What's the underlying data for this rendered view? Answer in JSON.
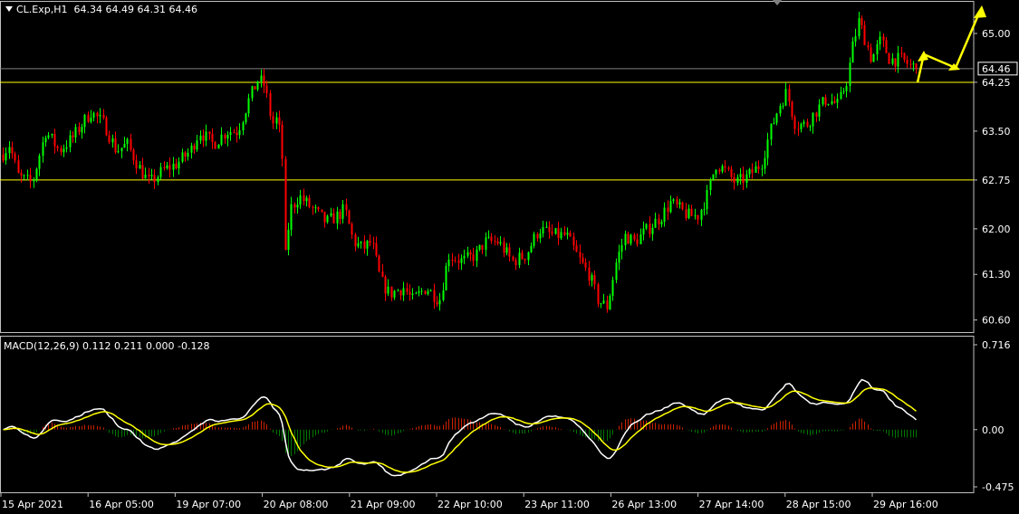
{
  "header": {
    "symbol": "CL.Exp,H1",
    "ohlc": "64.34 64.49 64.31 64.46"
  },
  "macd": {
    "label": "MACD(12,26,9) 0.112 0.211 0.000 -0.128"
  },
  "price_axis": {
    "ticks": [
      "65.00",
      "64.25",
      "63.50",
      "62.75",
      "62.00",
      "61.30",
      "60.60"
    ],
    "current_price": "64.46"
  },
  "macd_axis": {
    "ticks": [
      "0.716",
      "0.00",
      "-0.475"
    ]
  },
  "time_axis": {
    "labels": [
      "15 Apr 2021",
      "16 Apr 05:00",
      "19 Apr 07:00",
      "20 Apr 08:00",
      "21 Apr 09:00",
      "22 Apr 10:00",
      "23 Apr 11:00",
      "26 Apr 13:00",
      "27 Apr 14:00",
      "28 Apr 15:00",
      "29 Apr 16:00"
    ]
  },
  "colors": {
    "background": "#000000",
    "bull_candle": "#00ff00",
    "bear_candle": "#ff0000",
    "horizontal_lines": "#ffff00",
    "current_price_line": "#808080",
    "macd_line": "#ffffff",
    "signal_line": "#ffff00",
    "arrows": "#ffff00"
  },
  "horizontal_levels": [
    64.25,
    62.75
  ],
  "chart_data": {
    "type": "candlestick",
    "price_ylim": [
      60.4,
      65.5
    ],
    "macd_ylim": [
      -0.5,
      0.75
    ],
    "price_path": [
      [
        0,
        63.1
      ],
      [
        10,
        63.3
      ],
      [
        20,
        62.8
      ],
      [
        35,
        62.7
      ],
      [
        50,
        63.5
      ],
      [
        65,
        63.2
      ],
      [
        80,
        63.4
      ],
      [
        100,
        63.8
      ],
      [
        115,
        63.6
      ],
      [
        128,
        63.2
      ],
      [
        140,
        63.3
      ],
      [
        155,
        62.9
      ],
      [
        165,
        62.7
      ],
      [
        180,
        62.9
      ],
      [
        195,
        63.0
      ],
      [
        210,
        63.2
      ],
      [
        220,
        63.5
      ],
      [
        235,
        63.3
      ],
      [
        250,
        63.5
      ],
      [
        262,
        63.5
      ],
      [
        275,
        64.0
      ],
      [
        285,
        64.3
      ],
      [
        292,
        64.2
      ],
      [
        300,
        63.6
      ],
      [
        306,
        63.7
      ],
      [
        311,
        63.2
      ],
      [
        314,
        61.5
      ],
      [
        320,
        62.3
      ],
      [
        330,
        62.5
      ],
      [
        345,
        62.3
      ],
      [
        360,
        62.1
      ],
      [
        372,
        62.2
      ],
      [
        380,
        62.3
      ],
      [
        390,
        61.8
      ],
      [
        400,
        61.7
      ],
      [
        410,
        61.8
      ],
      [
        420,
        61.2
      ],
      [
        430,
        61.0
      ],
      [
        445,
        61.1
      ],
      [
        455,
        60.9
      ],
      [
        470,
        61.1
      ],
      [
        485,
        60.9
      ],
      [
        495,
        61.6
      ],
      [
        510,
        61.5
      ],
      [
        525,
        61.6
      ],
      [
        535,
        61.8
      ],
      [
        550,
        61.8
      ],
      [
        565,
        61.5
      ],
      [
        580,
        61.6
      ],
      [
        595,
        62.0
      ],
      [
        610,
        61.9
      ],
      [
        625,
        61.9
      ],
      [
        640,
        61.5
      ],
      [
        650,
        61.3
      ],
      [
        660,
        60.9
      ],
      [
        670,
        60.8
      ],
      [
        680,
        61.5
      ],
      [
        690,
        61.9
      ],
      [
        700,
        61.8
      ],
      [
        715,
        62.0
      ],
      [
        730,
        62.2
      ],
      [
        740,
        62.4
      ],
      [
        750,
        62.3
      ],
      [
        760,
        62.2
      ],
      [
        770,
        62.2
      ],
      [
        780,
        62.5
      ],
      [
        790,
        63.0
      ],
      [
        800,
        62.9
      ],
      [
        812,
        62.7
      ],
      [
        825,
        62.8
      ],
      [
        840,
        63.0
      ],
      [
        850,
        63.5
      ],
      [
        860,
        63.9
      ],
      [
        868,
        64.1
      ],
      [
        878,
        63.6
      ],
      [
        890,
        63.6
      ],
      [
        900,
        63.8
      ],
      [
        912,
        64.0
      ],
      [
        925,
        63.9
      ],
      [
        935,
        64.3
      ],
      [
        941,
        64.8
      ],
      [
        948,
        65.2
      ],
      [
        955,
        64.9
      ],
      [
        962,
        64.6
      ],
      [
        972,
        64.9
      ],
      [
        982,
        64.6
      ],
      [
        995,
        64.6
      ],
      [
        1005,
        64.5
      ],
      [
        1015,
        64.46
      ]
    ]
  },
  "annotations": {
    "arrows": "yellow projection arrows"
  }
}
